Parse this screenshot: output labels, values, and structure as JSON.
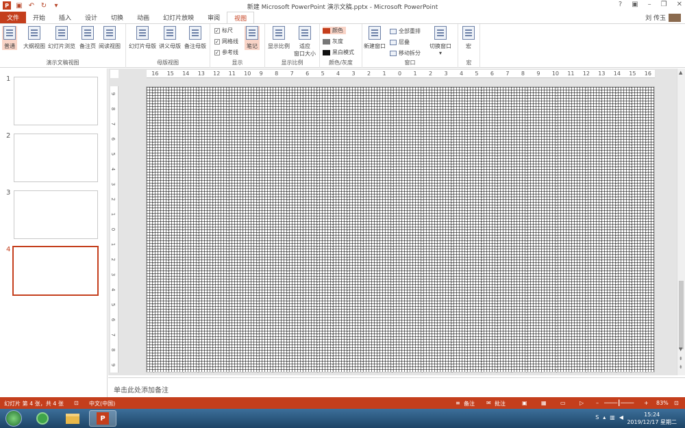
{
  "window": {
    "title": "新建 Microsoft PowerPoint 演示文稿.pptx - Microsoft PowerPoint",
    "help": "?",
    "user_name": "刘 传玉"
  },
  "tabs": [
    "文件",
    "开始",
    "插入",
    "设计",
    "切换",
    "动画",
    "幻灯片放映",
    "审阅",
    "视图"
  ],
  "active_tab": "视图",
  "ribbon": {
    "presentation_views": {
      "label": "演示文稿视图",
      "buttons": [
        "普通",
        "大纲视图",
        "幻灯片浏览",
        "备注页",
        "阅读视图"
      ]
    },
    "master_views": {
      "label": "母版视图",
      "buttons": [
        "幻灯片母版",
        "讲义母版",
        "备注母版"
      ]
    },
    "show": {
      "label": "显示",
      "checks": [
        {
          "label": "标尺",
          "checked": true
        },
        {
          "label": "网格线",
          "checked": true
        },
        {
          "label": "参考线",
          "checked": true
        }
      ],
      "notes_button": "笔记"
    },
    "zoom": {
      "label": "显示比例",
      "zoom_button": "显示比例",
      "fit_button_line1": "适应",
      "fit_button_line2": "窗口大小"
    },
    "color": {
      "label": "颜色/灰度",
      "items": [
        {
          "label": "颜色",
          "color": "#c43e1c"
        },
        {
          "label": "灰度",
          "color": "#777777"
        },
        {
          "label": "黑白模式",
          "color": "#111111"
        }
      ]
    },
    "window_group": {
      "label": "窗口",
      "new_window": "新建窗口",
      "items": [
        "全部重排",
        "层叠",
        "移动拆分"
      ],
      "switch_window": "切换窗口"
    },
    "macros": {
      "label": "宏",
      "button": "宏"
    }
  },
  "slides": [
    {
      "num": "1",
      "active": false
    },
    {
      "num": "2",
      "active": false
    },
    {
      "num": "3",
      "active": false
    },
    {
      "num": "4",
      "active": true
    }
  ],
  "ruler": {
    "h_ticks": [
      "16",
      "15",
      "14",
      "13",
      "12",
      "11",
      "10",
      "9",
      "8",
      "7",
      "6",
      "5",
      "4",
      "3",
      "2",
      "1",
      "0",
      "1",
      "2",
      "3",
      "4",
      "5",
      "6",
      "7",
      "8",
      "9",
      "10",
      "11",
      "12",
      "13",
      "14",
      "15",
      "16"
    ],
    "v_ticks": [
      "9",
      "8",
      "7",
      "6",
      "5",
      "4",
      "3",
      "2",
      "1",
      "0",
      "1",
      "2",
      "3",
      "4",
      "5",
      "6",
      "7",
      "8",
      "9"
    ]
  },
  "notes_placeholder": "单击此处添加备注",
  "status": {
    "slide_info": "幻灯片 第 4 张，共 4 张",
    "language": "中文(中国)",
    "notes": "备注",
    "comments": "批注",
    "zoom": "83%"
  },
  "taskbar": {
    "time": "15:24",
    "date": "2019/12/17 星期二"
  },
  "colors": {
    "accent": "#c43e1c",
    "ribbon_bg": "#ffffff",
    "edit_bg": "#e4e4e4"
  }
}
